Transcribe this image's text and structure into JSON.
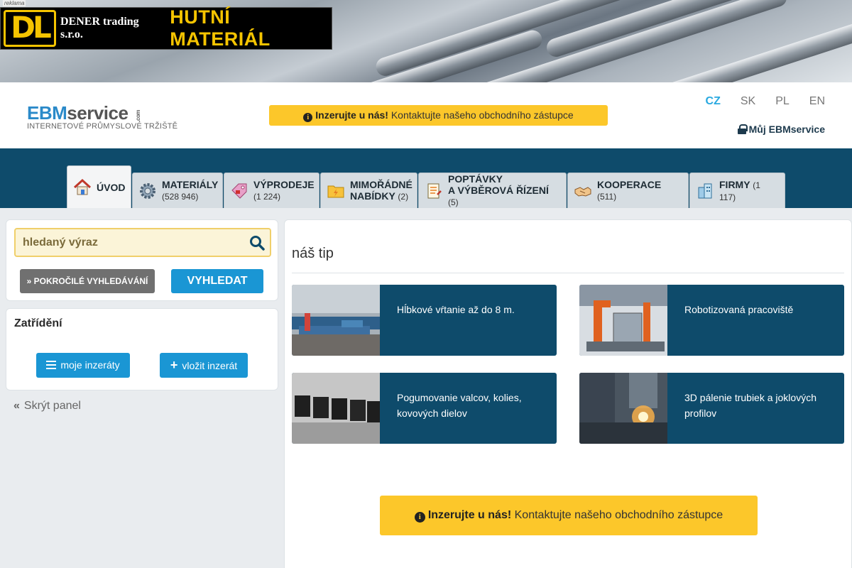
{
  "banner": {
    "ad_tag": "reklama",
    "logo_text": "DL",
    "company": "DENER trading s.r.o.",
    "product": "HUTNÍ MATERIÁL"
  },
  "header": {
    "logo_ebm": "EBM",
    "logo_service": "service",
    "logo_com": ".com",
    "logo_subtitle": "INTERNETOVÉ PRŮMYSLOVÉ TRŽIŠTĚ",
    "promo_bold": "Inzerujte u nás!",
    "promo_text": "Kontaktujte našeho obchodního zástupce",
    "languages": [
      "CZ",
      "SK",
      "PL",
      "EN"
    ],
    "active_language": "CZ",
    "account_label": "Můj EBMservice"
  },
  "nav": {
    "tabs": [
      {
        "line1": "ÚVOD",
        "line2": "",
        "count": "",
        "icon": "home-icon"
      },
      {
        "line1": "MATERIÁLY",
        "line2": "",
        "count": "(528 946)",
        "icon": "gear-icon"
      },
      {
        "line1": "VÝPRODEJE",
        "line2": "",
        "count": "(1 224)",
        "icon": "price-tag-icon"
      },
      {
        "line1": "MIMOŘÁDNÉ",
        "line2": "NABÍDKY",
        "count": "(2)",
        "icon": "folder-icon"
      },
      {
        "line1": "POPTÁVKY",
        "line2": "A VÝBĚROVÁ ŘÍZENÍ",
        "count": "(5)",
        "icon": "document-icon"
      },
      {
        "line1": "KOOPERACE",
        "line2": "",
        "count": "(511)",
        "icon": "handshake-icon"
      },
      {
        "line1": "FIRMY",
        "line2": "",
        "count": "(1 117)",
        "icon": "building-icon"
      }
    ]
  },
  "search": {
    "placeholder": "hledaný výraz",
    "advanced_label": "POKROČILÉ VYHLEDÁVÁNÍ",
    "submit_label": "VYHLEDAT"
  },
  "sorting": {
    "title": "Zatřídění",
    "my_ads_label": "moje inzeráty",
    "insert_ad_label": "vložit inzerát"
  },
  "hide_panel_label": "Skrýt panel",
  "main": {
    "tip_title": "náš tip",
    "cards": [
      {
        "text": "Hĺbkové vŕtanie až do 8 m."
      },
      {
        "text": "Robotizovaná pracoviště"
      },
      {
        "text": "Pogumovanie valcov, kolies, kovových dielov"
      },
      {
        "text": "3D pálenie trubiek a joklových profilov"
      }
    ],
    "promo_bold": "Inzerujte u nás!",
    "promo_text": "Kontaktujte našeho obchodního zástupce"
  },
  "colors": {
    "nav_bg": "#0e4b6b",
    "accent_yellow": "#fcc72a",
    "button_blue": "#1a96d4",
    "lang_active": "#29a9e0"
  }
}
